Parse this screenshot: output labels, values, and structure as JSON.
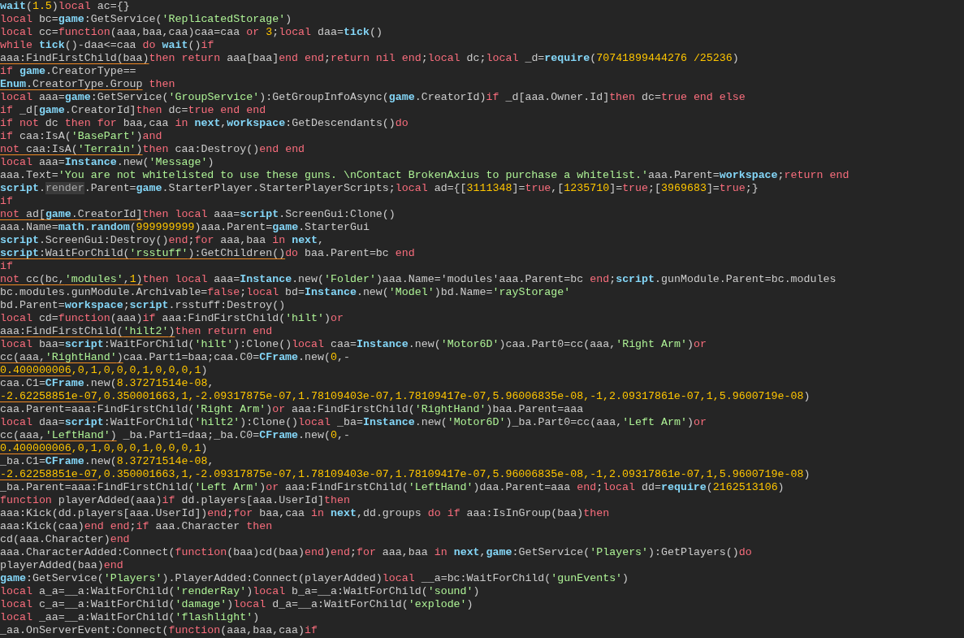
{
  "code_lines": [
    {
      "segments": [
        {
          "kind": "global",
          "text": "wait"
        },
        {
          "kind": "plain",
          "text": "("
        },
        {
          "kind": "number",
          "text": "1.5"
        },
        {
          "kind": "plain",
          "text": ")"
        },
        {
          "kind": "keyword",
          "text": "local"
        },
        {
          "kind": "plain",
          "text": " ac={}"
        }
      ]
    },
    {
      "segments": [
        {
          "kind": "keyword",
          "text": "local"
        },
        {
          "kind": "plain",
          "text": " bc="
        },
        {
          "kind": "global",
          "text": "game"
        },
        {
          "kind": "plain",
          "text": ":GetService("
        },
        {
          "kind": "string",
          "text": "'ReplicatedStorage'"
        },
        {
          "kind": "plain",
          "text": ")"
        }
      ]
    },
    {
      "segments": [
        {
          "kind": "keyword",
          "text": "local"
        },
        {
          "kind": "plain",
          "text": " cc="
        },
        {
          "kind": "keyword",
          "text": "function"
        },
        {
          "kind": "plain",
          "text": "(aaa,baa,caa)caa=caa "
        },
        {
          "kind": "keyword",
          "text": "or "
        },
        {
          "kind": "number",
          "text": "3"
        },
        {
          "kind": "plain",
          "text": ";"
        },
        {
          "kind": "keyword",
          "text": "local"
        },
        {
          "kind": "plain",
          "text": " daa="
        },
        {
          "kind": "global",
          "text": "tick"
        },
        {
          "kind": "plain",
          "text": "()"
        }
      ]
    },
    {
      "segments": [
        {
          "kind": "keyword",
          "text": "while "
        },
        {
          "kind": "global",
          "text": "tick"
        },
        {
          "kind": "plain",
          "text": "()-daa<=caa "
        },
        {
          "kind": "keyword",
          "text": "do "
        },
        {
          "kind": "global",
          "text": "wait"
        },
        {
          "kind": "plain",
          "text": "()"
        },
        {
          "kind": "keyword",
          "text": "if"
        }
      ]
    },
    {
      "segments": [
        {
          "kind": "plain",
          "text": "aaa:FindFirstChild(baa)",
          "underlined": true
        },
        {
          "kind": "keyword",
          "text": "then return",
          "underlined": false
        },
        {
          "kind": "plain",
          "text": " aaa[baa]",
          "underlined": false
        },
        {
          "kind": "keyword",
          "text": "end end",
          "underlined": false
        },
        {
          "kind": "plain",
          "text": ";",
          "underlined": false
        },
        {
          "kind": "keyword",
          "text": "return nil end",
          "underlined": false
        },
        {
          "kind": "plain",
          "text": ";",
          "underlined": false
        },
        {
          "kind": "keyword",
          "text": "local",
          "underlined": false
        },
        {
          "kind": "plain",
          "text": " dc;",
          "underlined": false
        },
        {
          "kind": "keyword",
          "text": "local",
          "underlined": false
        },
        {
          "kind": "plain",
          "text": " _d=",
          "underlined": false
        },
        {
          "kind": "global",
          "text": "require",
          "underlined": false
        },
        {
          "kind": "plain",
          "text": "(",
          "underlined": false
        },
        {
          "kind": "number",
          "text": "70741899444276 /25236",
          "underlined": false
        },
        {
          "kind": "plain",
          "text": ")",
          "underlined": false
        }
      ]
    },
    {
      "segments": [
        {
          "kind": "keyword",
          "text": "if "
        },
        {
          "kind": "global",
          "text": "game"
        },
        {
          "kind": "plain",
          "text": ".CreatorType=="
        }
      ]
    },
    {
      "segments": [
        {
          "kind": "global",
          "text": "Enum",
          "underlined": true
        },
        {
          "kind": "plain",
          "text": ".CreatorType.Group",
          "underlined": true
        },
        {
          "kind": "keyword",
          "text": " then",
          "underlined": false
        }
      ]
    },
    {
      "segments": [
        {
          "kind": "keyword",
          "text": "local"
        },
        {
          "kind": "plain",
          "text": " aaa="
        },
        {
          "kind": "global",
          "text": "game"
        },
        {
          "kind": "plain",
          "text": ":GetService("
        },
        {
          "kind": "string",
          "text": "'GroupService'"
        },
        {
          "kind": "plain",
          "text": "):GetGroupInfoAsync("
        },
        {
          "kind": "global",
          "text": "game"
        },
        {
          "kind": "plain",
          "text": ".CreatorId)"
        },
        {
          "kind": "keyword",
          "text": "if"
        },
        {
          "kind": "plain",
          "text": " _d[aaa.Owner.Id]"
        },
        {
          "kind": "keyword",
          "text": "then"
        },
        {
          "kind": "plain",
          "text": " dc="
        },
        {
          "kind": "keyword",
          "text": "true end else"
        }
      ]
    },
    {
      "segments": [
        {
          "kind": "keyword",
          "text": "if"
        },
        {
          "kind": "plain",
          "text": " _d["
        },
        {
          "kind": "global",
          "text": "game"
        },
        {
          "kind": "plain",
          "text": ".CreatorId]"
        },
        {
          "kind": "keyword",
          "text": "then"
        },
        {
          "kind": "plain",
          "text": " dc="
        },
        {
          "kind": "keyword",
          "text": "true end end"
        }
      ]
    },
    {
      "segments": [
        {
          "kind": "keyword",
          "text": "if not"
        },
        {
          "kind": "plain",
          "text": " dc "
        },
        {
          "kind": "keyword",
          "text": "then for"
        },
        {
          "kind": "plain",
          "text": " baa,caa "
        },
        {
          "kind": "keyword",
          "text": "in "
        },
        {
          "kind": "global",
          "text": "next"
        },
        {
          "kind": "plain",
          "text": ","
        },
        {
          "kind": "global",
          "text": "workspace"
        },
        {
          "kind": "plain",
          "text": ":GetDescendants()"
        },
        {
          "kind": "keyword",
          "text": "do"
        }
      ]
    },
    {
      "segments": [
        {
          "kind": "keyword",
          "text": "if"
        },
        {
          "kind": "plain",
          "text": " caa:IsA("
        },
        {
          "kind": "string",
          "text": "'BasePart'"
        },
        {
          "kind": "plain",
          "text": ")"
        },
        {
          "kind": "keyword",
          "text": "and"
        }
      ]
    },
    {
      "segments": [
        {
          "kind": "keyword",
          "text": "not",
          "underlined": true
        },
        {
          "kind": "plain",
          "text": " caa:IsA(",
          "underlined": true
        },
        {
          "kind": "string",
          "text": "'Terrain'",
          "underlined": true
        },
        {
          "kind": "plain",
          "text": ")",
          "underlined": true
        },
        {
          "kind": "keyword",
          "text": "then",
          "underlined": false
        },
        {
          "kind": "plain",
          "text": " caa:Destroy()",
          "underlined": false
        },
        {
          "kind": "keyword",
          "text": "end end",
          "underlined": false
        }
      ]
    },
    {
      "segments": [
        {
          "kind": "keyword",
          "text": "local"
        },
        {
          "kind": "plain",
          "text": " aaa="
        },
        {
          "kind": "global",
          "text": "Instance"
        },
        {
          "kind": "plain",
          "text": ".new("
        },
        {
          "kind": "string",
          "text": "'Message'"
        },
        {
          "kind": "plain",
          "text": ")"
        }
      ]
    },
    {
      "segments": [
        {
          "kind": "plain",
          "text": "aaa.Text="
        },
        {
          "kind": "string",
          "text": "'You are not whitelisted to use these guns. \\nContact BrokenAxius to purchase a whitelist.'"
        },
        {
          "kind": "plain",
          "text": "aaa.Parent="
        },
        {
          "kind": "global",
          "text": "workspace"
        },
        {
          "kind": "plain",
          "text": ";"
        },
        {
          "kind": "keyword",
          "text": "return end"
        }
      ]
    },
    {
      "segments": [
        {
          "kind": "global",
          "text": "script"
        },
        {
          "kind": "plain",
          "text": "."
        },
        {
          "kind": "highlight",
          "text": "render"
        },
        {
          "kind": "plain",
          "text": ".Parent="
        },
        {
          "kind": "global",
          "text": "game"
        },
        {
          "kind": "plain",
          "text": ".StarterPlayer.StarterPlayerScripts;"
        },
        {
          "kind": "keyword",
          "text": "local"
        },
        {
          "kind": "plain",
          "text": " ad={["
        },
        {
          "kind": "number",
          "text": "3111348"
        },
        {
          "kind": "plain",
          "text": "]="
        },
        {
          "kind": "keyword",
          "text": "true"
        },
        {
          "kind": "plain",
          "text": ",["
        },
        {
          "kind": "number",
          "text": "1235710"
        },
        {
          "kind": "plain",
          "text": "]="
        },
        {
          "kind": "keyword",
          "text": "true"
        },
        {
          "kind": "plain",
          "text": ";["
        },
        {
          "kind": "number",
          "text": "3969683"
        },
        {
          "kind": "plain",
          "text": "]="
        },
        {
          "kind": "keyword",
          "text": "true"
        },
        {
          "kind": "plain",
          "text": ";}"
        }
      ]
    },
    {
      "segments": [
        {
          "kind": "keyword",
          "text": "if"
        }
      ]
    },
    {
      "segments": [
        {
          "kind": "keyword",
          "text": "not",
          "underlined": true
        },
        {
          "kind": "plain",
          "text": " ad[",
          "underlined": true
        },
        {
          "kind": "global",
          "text": "game",
          "underlined": true
        },
        {
          "kind": "plain",
          "text": ".CreatorId]",
          "underlined": true
        },
        {
          "kind": "keyword",
          "text": "then local",
          "underlined": false
        },
        {
          "kind": "plain",
          "text": " aaa=",
          "underlined": false
        },
        {
          "kind": "global",
          "text": "script",
          "underlined": false
        },
        {
          "kind": "plain",
          "text": ".ScreenGui:Clone()",
          "underlined": false
        }
      ]
    },
    {
      "segments": [
        {
          "kind": "plain",
          "text": "aaa.Name="
        },
        {
          "kind": "global",
          "text": "math"
        },
        {
          "kind": "plain",
          "text": "."
        },
        {
          "kind": "global",
          "text": "random"
        },
        {
          "kind": "plain",
          "text": "("
        },
        {
          "kind": "number",
          "text": "999999999"
        },
        {
          "kind": "plain",
          "text": ")aaa.Parent="
        },
        {
          "kind": "global",
          "text": "game"
        },
        {
          "kind": "plain",
          "text": ".StarterGui"
        }
      ]
    },
    {
      "segments": [
        {
          "kind": "global",
          "text": "script"
        },
        {
          "kind": "plain",
          "text": ".ScreenGui:Destroy()"
        },
        {
          "kind": "keyword",
          "text": "end"
        },
        {
          "kind": "plain",
          "text": ";"
        },
        {
          "kind": "keyword",
          "text": "for"
        },
        {
          "kind": "plain",
          "text": " aaa,baa "
        },
        {
          "kind": "keyword",
          "text": "in "
        },
        {
          "kind": "global",
          "text": "next"
        },
        {
          "kind": "plain",
          "text": ","
        }
      ]
    },
    {
      "segments": [
        {
          "kind": "global",
          "text": "script",
          "underlined": true
        },
        {
          "kind": "plain",
          "text": ":WaitForChild(",
          "underlined": true
        },
        {
          "kind": "string",
          "text": "'rsstuff'",
          "underlined": true
        },
        {
          "kind": "plain",
          "text": "):GetChildren()",
          "underlined": true
        },
        {
          "kind": "keyword",
          "text": "do",
          "underlined": false
        },
        {
          "kind": "plain",
          "text": " baa.Parent=bc ",
          "underlined": false
        },
        {
          "kind": "keyword",
          "text": "end",
          "underlined": false
        }
      ]
    },
    {
      "segments": [
        {
          "kind": "keyword",
          "text": "if"
        }
      ]
    },
    {
      "segments": [
        {
          "kind": "keyword",
          "text": "not",
          "underlined": true
        },
        {
          "kind": "plain",
          "text": " cc(bc,",
          "underlined": true
        },
        {
          "kind": "string",
          "text": "'modules'",
          "underlined": true
        },
        {
          "kind": "plain",
          "text": ",",
          "underlined": true
        },
        {
          "kind": "number",
          "text": "1",
          "underlined": true
        },
        {
          "kind": "plain",
          "text": ")",
          "underlined": true
        },
        {
          "kind": "keyword",
          "text": "then local",
          "underlined": false
        },
        {
          "kind": "plain",
          "text": " aaa=",
          "underlined": false
        },
        {
          "kind": "global",
          "text": "Instance",
          "underlined": false
        },
        {
          "kind": "plain",
          "text": ".new(",
          "underlined": false
        },
        {
          "kind": "string",
          "text": "'Folder'",
          "underlined": false
        },
        {
          "kind": "plain",
          "text": ")aaa.Name='modules'aaa.Parent=bc ",
          "underlined": false
        },
        {
          "kind": "keyword",
          "text": "end",
          "underlined": false
        },
        {
          "kind": "plain",
          "text": ";",
          "underlined": false
        },
        {
          "kind": "global",
          "text": "script",
          "underlined": false
        },
        {
          "kind": "plain",
          "text": ".gunModule.Parent=bc.modules",
          "underlined": false
        }
      ]
    },
    {
      "segments": [
        {
          "kind": "plain",
          "text": "bc.modules.gunModule.Archivable="
        },
        {
          "kind": "keyword",
          "text": "false"
        },
        {
          "kind": "plain",
          "text": ";"
        },
        {
          "kind": "keyword",
          "text": "local"
        },
        {
          "kind": "plain",
          "text": " bd="
        },
        {
          "kind": "global",
          "text": "Instance"
        },
        {
          "kind": "plain",
          "text": ".new("
        },
        {
          "kind": "string",
          "text": "'Model'"
        },
        {
          "kind": "plain",
          "text": ")bd.Name="
        },
        {
          "kind": "string",
          "text": "'rayStorage'"
        }
      ]
    },
    {
      "segments": [
        {
          "kind": "plain",
          "text": "bd.Parent="
        },
        {
          "kind": "global",
          "text": "workspace"
        },
        {
          "kind": "plain",
          "text": ";"
        },
        {
          "kind": "global",
          "text": "script"
        },
        {
          "kind": "plain",
          "text": ".rsstuff:Destroy()"
        }
      ]
    },
    {
      "segments": [
        {
          "kind": "keyword",
          "text": "local"
        },
        {
          "kind": "plain",
          "text": " cd="
        },
        {
          "kind": "keyword",
          "text": "function"
        },
        {
          "kind": "plain",
          "text": "(aaa)"
        },
        {
          "kind": "keyword",
          "text": "if"
        },
        {
          "kind": "plain",
          "text": " aaa:FindFirstChild("
        },
        {
          "kind": "string",
          "text": "'hilt'"
        },
        {
          "kind": "plain",
          "text": ")"
        },
        {
          "kind": "keyword",
          "text": "or"
        }
      ]
    },
    {
      "segments": [
        {
          "kind": "plain",
          "text": "aaa:FindFirstChild(",
          "underlined": true
        },
        {
          "kind": "string",
          "text": "'hilt2'",
          "underlined": true
        },
        {
          "kind": "plain",
          "text": ")",
          "underlined": true
        },
        {
          "kind": "keyword",
          "text": "then return end",
          "underlined": false
        }
      ]
    },
    {
      "segments": [
        {
          "kind": "keyword",
          "text": "local"
        },
        {
          "kind": "plain",
          "text": " baa="
        },
        {
          "kind": "global",
          "text": "script"
        },
        {
          "kind": "plain",
          "text": ":WaitForChild("
        },
        {
          "kind": "string",
          "text": "'hilt'"
        },
        {
          "kind": "plain",
          "text": "):Clone()"
        },
        {
          "kind": "keyword",
          "text": "local"
        },
        {
          "kind": "plain",
          "text": " caa="
        },
        {
          "kind": "global",
          "text": "Instance"
        },
        {
          "kind": "plain",
          "text": ".new("
        },
        {
          "kind": "string",
          "text": "'Motor6D'"
        },
        {
          "kind": "plain",
          "text": ")caa.Part0=cc(aaa,"
        },
        {
          "kind": "string",
          "text": "'Right Arm'"
        },
        {
          "kind": "plain",
          "text": ")"
        },
        {
          "kind": "keyword",
          "text": "or"
        }
      ]
    },
    {
      "segments": [
        {
          "kind": "plain",
          "text": "cc(aaa,",
          "underlined": true
        },
        {
          "kind": "string",
          "text": "'RightHand'",
          "underlined": true
        },
        {
          "kind": "plain",
          "text": ")",
          "underlined": true
        },
        {
          "kind": "plain",
          "text": "caa.Part1=baa;caa.C0=",
          "underlined": false
        },
        {
          "kind": "global",
          "text": "CFrame",
          "underlined": false
        },
        {
          "kind": "plain",
          "text": ".new(",
          "underlined": false
        },
        {
          "kind": "number",
          "text": "0",
          "underlined": false
        },
        {
          "kind": "plain",
          "text": ",-",
          "underlined": false
        }
      ]
    },
    {
      "segments": [
        {
          "kind": "number",
          "text": "0.400000006",
          "underlined": true
        },
        {
          "kind": "number",
          "text": ",0,1,0,0,0,1,0,0,0,1",
          "underlined": false
        },
        {
          "kind": "plain",
          "text": ")",
          "underlined": false
        }
      ]
    },
    {
      "segments": [
        {
          "kind": "plain",
          "text": "caa.C1="
        },
        {
          "kind": "global",
          "text": "CFrame"
        },
        {
          "kind": "plain",
          "text": ".new("
        },
        {
          "kind": "number",
          "text": "8.37271514e-08"
        },
        {
          "kind": "plain",
          "text": ","
        }
      ]
    },
    {
      "segments": [
        {
          "kind": "number",
          "text": "-2.62258851e-07",
          "underlined": true
        },
        {
          "kind": "number",
          "text": ",0.350001663,1,-2.09317875e-07,1.78109403e-07,1.78109417e-07,5.96006835e-08,-1,2.09317861e-07,1,5.9600719e-08",
          "underlined": false
        },
        {
          "kind": "plain",
          "text": ")",
          "underlined": false
        }
      ]
    },
    {
      "segments": [
        {
          "kind": "plain",
          "text": "caa.Parent=aaa:FindFirstChild("
        },
        {
          "kind": "string",
          "text": "'Right Arm'"
        },
        {
          "kind": "plain",
          "text": ")"
        },
        {
          "kind": "keyword",
          "text": "or"
        },
        {
          "kind": "plain",
          "text": " aaa:FindFirstChild("
        },
        {
          "kind": "string",
          "text": "'RightHand'"
        },
        {
          "kind": "plain",
          "text": ")baa.Parent=aaa"
        }
      ]
    },
    {
      "segments": [
        {
          "kind": "keyword",
          "text": "local"
        },
        {
          "kind": "plain",
          "text": " daa="
        },
        {
          "kind": "global",
          "text": "script"
        },
        {
          "kind": "plain",
          "text": ":WaitForChild("
        },
        {
          "kind": "string",
          "text": "'hilt2'"
        },
        {
          "kind": "plain",
          "text": "):Clone()"
        },
        {
          "kind": "keyword",
          "text": "local"
        },
        {
          "kind": "plain",
          "text": " _ba="
        },
        {
          "kind": "global",
          "text": "Instance"
        },
        {
          "kind": "plain",
          "text": ".new("
        },
        {
          "kind": "string",
          "text": "'Motor6D'"
        },
        {
          "kind": "plain",
          "text": ")_ba.Part0=cc(aaa,"
        },
        {
          "kind": "string",
          "text": "'Left Arm'"
        },
        {
          "kind": "plain",
          "text": ")"
        },
        {
          "kind": "keyword",
          "text": "or"
        }
      ]
    },
    {
      "segments": [
        {
          "kind": "plain",
          "text": "cc(aaa,",
          "underlined": true
        },
        {
          "kind": "string",
          "text": "'LeftHand'",
          "underlined": true
        },
        {
          "kind": "plain",
          "text": ")",
          "underlined": true
        },
        {
          "kind": "plain",
          "text": " _ba.Part1=daa;_ba.C0=",
          "underlined": false
        },
        {
          "kind": "global",
          "text": "CFrame",
          "underlined": false
        },
        {
          "kind": "plain",
          "text": ".new(",
          "underlined": false
        },
        {
          "kind": "number",
          "text": "0",
          "underlined": false
        },
        {
          "kind": "plain",
          "text": ",-",
          "underlined": false
        }
      ]
    },
    {
      "segments": [
        {
          "kind": "number",
          "text": "0.400000006",
          "underlined": true
        },
        {
          "kind": "number",
          "text": ",0,1,0,0,0,1,0,0,0,1",
          "underlined": false
        },
        {
          "kind": "plain",
          "text": ")",
          "underlined": false
        }
      ]
    },
    {
      "segments": [
        {
          "kind": "plain",
          "text": "_ba.C1="
        },
        {
          "kind": "global",
          "text": "CFrame"
        },
        {
          "kind": "plain",
          "text": ".new("
        },
        {
          "kind": "number",
          "text": "8.37271514e-08"
        },
        {
          "kind": "plain",
          "text": ","
        }
      ]
    },
    {
      "segments": [
        {
          "kind": "number",
          "text": "-2.62258851e-07",
          "underlined": true
        },
        {
          "kind": "number",
          "text": ",0.350001663,1,-2.09317875e-07,1.78109403e-07,1.78109417e-07,5.96006835e-08,-1,2.09317861e-07,1,5.9600719e-08",
          "underlined": false
        },
        {
          "kind": "plain",
          "text": ")",
          "underlined": false
        }
      ]
    },
    {
      "segments": [
        {
          "kind": "plain",
          "text": "_ba.Parent=aaa:FindFirstChild("
        },
        {
          "kind": "string",
          "text": "'Left Arm'"
        },
        {
          "kind": "plain",
          "text": ")"
        },
        {
          "kind": "keyword",
          "text": "or"
        },
        {
          "kind": "plain",
          "text": " aaa:FindFirstChild("
        },
        {
          "kind": "string",
          "text": "'LeftHand'"
        },
        {
          "kind": "plain",
          "text": ")daa.Parent=aaa "
        },
        {
          "kind": "keyword",
          "text": "end"
        },
        {
          "kind": "plain",
          "text": ";"
        },
        {
          "kind": "keyword",
          "text": "local"
        },
        {
          "kind": "plain",
          "text": " dd="
        },
        {
          "kind": "global",
          "text": "require"
        },
        {
          "kind": "plain",
          "text": "("
        },
        {
          "kind": "number",
          "text": "2162513106"
        },
        {
          "kind": "plain",
          "text": ")"
        }
      ]
    },
    {
      "segments": [
        {
          "kind": "keyword",
          "text": "function"
        },
        {
          "kind": "plain",
          "text": " playerAdded(aaa)"
        },
        {
          "kind": "keyword",
          "text": "if"
        },
        {
          "kind": "plain",
          "text": " dd.players[aaa.UserId]"
        },
        {
          "kind": "keyword",
          "text": "then"
        }
      ]
    },
    {
      "segments": [
        {
          "kind": "plain",
          "text": "aaa:Kick(dd.players[aaa.UserId])"
        },
        {
          "kind": "keyword",
          "text": "end"
        },
        {
          "kind": "plain",
          "text": ";"
        },
        {
          "kind": "keyword",
          "text": "for"
        },
        {
          "kind": "plain",
          "text": " baa,caa "
        },
        {
          "kind": "keyword",
          "text": "in "
        },
        {
          "kind": "global",
          "text": "next"
        },
        {
          "kind": "plain",
          "text": ",dd.groups "
        },
        {
          "kind": "keyword",
          "text": "do if"
        },
        {
          "kind": "plain",
          "text": " aaa:IsInGroup(baa)"
        },
        {
          "kind": "keyword",
          "text": "then"
        }
      ]
    },
    {
      "segments": [
        {
          "kind": "plain",
          "text": "aaa:Kick(caa)"
        },
        {
          "kind": "keyword",
          "text": "end end"
        },
        {
          "kind": "plain",
          "text": ";"
        },
        {
          "kind": "keyword",
          "text": "if"
        },
        {
          "kind": "plain",
          "text": " aaa.Character "
        },
        {
          "kind": "keyword",
          "text": "then"
        }
      ]
    },
    {
      "segments": [
        {
          "kind": "plain",
          "text": "cd(aaa.Character)"
        },
        {
          "kind": "keyword",
          "text": "end"
        }
      ]
    },
    {
      "segments": [
        {
          "kind": "plain",
          "text": "aaa.CharacterAdded:Connect("
        },
        {
          "kind": "keyword",
          "text": "function"
        },
        {
          "kind": "plain",
          "text": "(baa)cd(baa)"
        },
        {
          "kind": "keyword",
          "text": "end"
        },
        {
          "kind": "plain",
          "text": ")"
        },
        {
          "kind": "keyword",
          "text": "end"
        },
        {
          "kind": "plain",
          "text": ";"
        },
        {
          "kind": "keyword",
          "text": "for"
        },
        {
          "kind": "plain",
          "text": " aaa,baa "
        },
        {
          "kind": "keyword",
          "text": "in "
        },
        {
          "kind": "global",
          "text": "next"
        },
        {
          "kind": "plain",
          "text": ","
        },
        {
          "kind": "global",
          "text": "game"
        },
        {
          "kind": "plain",
          "text": ":GetService("
        },
        {
          "kind": "string",
          "text": "'Players'"
        },
        {
          "kind": "plain",
          "text": "):GetPlayers()"
        },
        {
          "kind": "keyword",
          "text": "do"
        }
      ]
    },
    {
      "segments": [
        {
          "kind": "plain",
          "text": "playerAdded(baa)"
        },
        {
          "kind": "keyword",
          "text": "end"
        }
      ]
    },
    {
      "segments": [
        {
          "kind": "global",
          "text": "game"
        },
        {
          "kind": "plain",
          "text": ":GetService("
        },
        {
          "kind": "string",
          "text": "'Players'"
        },
        {
          "kind": "plain",
          "text": ").PlayerAdded:Connect(playerAdded)"
        },
        {
          "kind": "keyword",
          "text": "local"
        },
        {
          "kind": "plain",
          "text": " __a=bc:WaitForChild("
        },
        {
          "kind": "string",
          "text": "'gunEvents'"
        },
        {
          "kind": "plain",
          "text": ")"
        }
      ]
    },
    {
      "segments": [
        {
          "kind": "keyword",
          "text": "local"
        },
        {
          "kind": "plain",
          "text": " a_a=__a:WaitForChild("
        },
        {
          "kind": "string",
          "text": "'renderRay'"
        },
        {
          "kind": "plain",
          "text": ")"
        },
        {
          "kind": "keyword",
          "text": "local"
        },
        {
          "kind": "plain",
          "text": " b_a=__a:WaitForChild("
        },
        {
          "kind": "string",
          "text": "'sound'"
        },
        {
          "kind": "plain",
          "text": ")"
        }
      ]
    },
    {
      "segments": [
        {
          "kind": "keyword",
          "text": "local"
        },
        {
          "kind": "plain",
          "text": " c_a=__a:WaitForChild("
        },
        {
          "kind": "string",
          "text": "'damage'"
        },
        {
          "kind": "plain",
          "text": ")"
        },
        {
          "kind": "keyword",
          "text": "local"
        },
        {
          "kind": "plain",
          "text": " d_a=__a:WaitForChild("
        },
        {
          "kind": "string",
          "text": "'explode'"
        },
        {
          "kind": "plain",
          "text": ")"
        }
      ]
    },
    {
      "segments": [
        {
          "kind": "keyword",
          "text": "local"
        },
        {
          "kind": "plain",
          "text": " _aa=__a:WaitForChild("
        },
        {
          "kind": "string",
          "text": "'flashlight'"
        },
        {
          "kind": "plain",
          "text": ")"
        }
      ]
    },
    {
      "segments": [
        {
          "kind": "plain",
          "text": "_aa.OnServerEvent:Connect("
        },
        {
          "kind": "keyword",
          "text": "function"
        },
        {
          "kind": "plain",
          "text": "(aaa,baa,caa)"
        },
        {
          "kind": "keyword",
          "text": "if"
        }
      ]
    }
  ]
}
